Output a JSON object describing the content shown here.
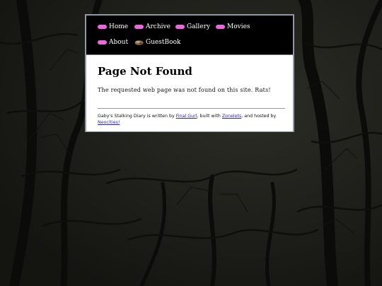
{
  "nav": {
    "items": [
      {
        "label": "Home",
        "icon": "pink-pill-icon"
      },
      {
        "label": "Archive",
        "icon": "pink-pill-icon"
      },
      {
        "label": "Gallery",
        "icon": "pink-pill-icon"
      },
      {
        "label": "Movies",
        "icon": "pink-pill-icon"
      },
      {
        "label": "About",
        "icon": "pink-pill-icon"
      },
      {
        "label": "GuestBook",
        "icon": "rock-icon"
      }
    ]
  },
  "main": {
    "title": "Page Not Found",
    "message": "The requested web page was not found on this site. Rats!"
  },
  "footer": {
    "prefix": "Gaby's Stalking Diary is written by ",
    "author_link": "Final Gurl",
    "mid1": ", built with ",
    "builder_link": "Zonelets",
    "mid2": ", and hosted by ",
    "host_link": "Neocities!"
  },
  "colors": {
    "pill": "#ee66dd",
    "link": "#2a1fd1",
    "frame": "#8f9aa3",
    "nav_bg": "#000000"
  }
}
